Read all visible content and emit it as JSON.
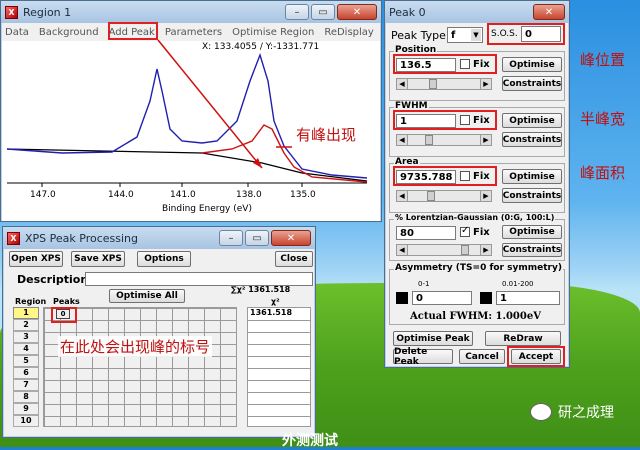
{
  "region_window": {
    "title": "Region 1",
    "menu": [
      "Data",
      "Background",
      "Add Peak",
      "Parameters",
      "Optimise Region",
      "ReDisplay"
    ],
    "coords": "X: 133.4055 / Y:-1331.771",
    "xlabel": "Binding Energy (eV)",
    "ticks": [
      "147.0",
      "144.0",
      "141.0",
      "138.0",
      "135.0"
    ],
    "annotation": "有峰出现"
  },
  "xps_window": {
    "title": "XPS Peak Processing",
    "buttons": {
      "open": "Open XPS",
      "save": "Save XPS",
      "options": "Options",
      "close": "Close"
    },
    "description_label": "Description",
    "region_label": "Region",
    "peaks_label": "Peaks",
    "optimise_all": "Optimise All",
    "chi_header": "∑χ²  1361.518",
    "chi_label": "χ²",
    "chi_value": "1361.518",
    "peak_tag": "0",
    "rows": [
      "1",
      "2",
      "3",
      "4",
      "5",
      "6",
      "7",
      "8",
      "9",
      "10"
    ],
    "annotation": "在此处会出现峰的标号"
  },
  "peak_window": {
    "title": "Peak 0",
    "peak_type_label": "Peak Type",
    "peak_type_value": "f",
    "sos_label": "S.O.S.",
    "sos_value": "0",
    "position": {
      "label": "Position",
      "value": "136.5",
      "fix": "Fix",
      "optimise": "Optimise",
      "constraints": "Constraints"
    },
    "fwhm": {
      "label": "FWHM",
      "value": "1",
      "fix": "Fix",
      "optimise": "Optimise",
      "constraints": "Constraints"
    },
    "area": {
      "label": "Area",
      "value": "9735.788",
      "fix": "Fix",
      "optimise": "Optimise",
      "constraints": "Constraints"
    },
    "lg": {
      "label": "% Lorentzian-Gaussian (0:G, 100:L)",
      "value": "80",
      "fix": "Fix",
      "optimise": "Optimise",
      "constraints": "Constraints"
    },
    "asym": {
      "label": "Asymmetry (TS=0 for symmetry)",
      "range1": "0-1",
      "range2": "0.01-200",
      "value1": "0",
      "value2": "1"
    },
    "actual_fwhm": "Actual FWHM:  1.000eV",
    "optimise_peak": "Optimise Peak",
    "redraw": "ReDraw",
    "delete_peak": "Delete Peak",
    "cancel": "Cancel",
    "accept": "Accept"
  },
  "annotations": {
    "position": "峰位置",
    "fwhm": "半峰宽",
    "area": "峰面积"
  },
  "watermark": {
    "text": "研之成理",
    "footer": "外测测试"
  }
}
